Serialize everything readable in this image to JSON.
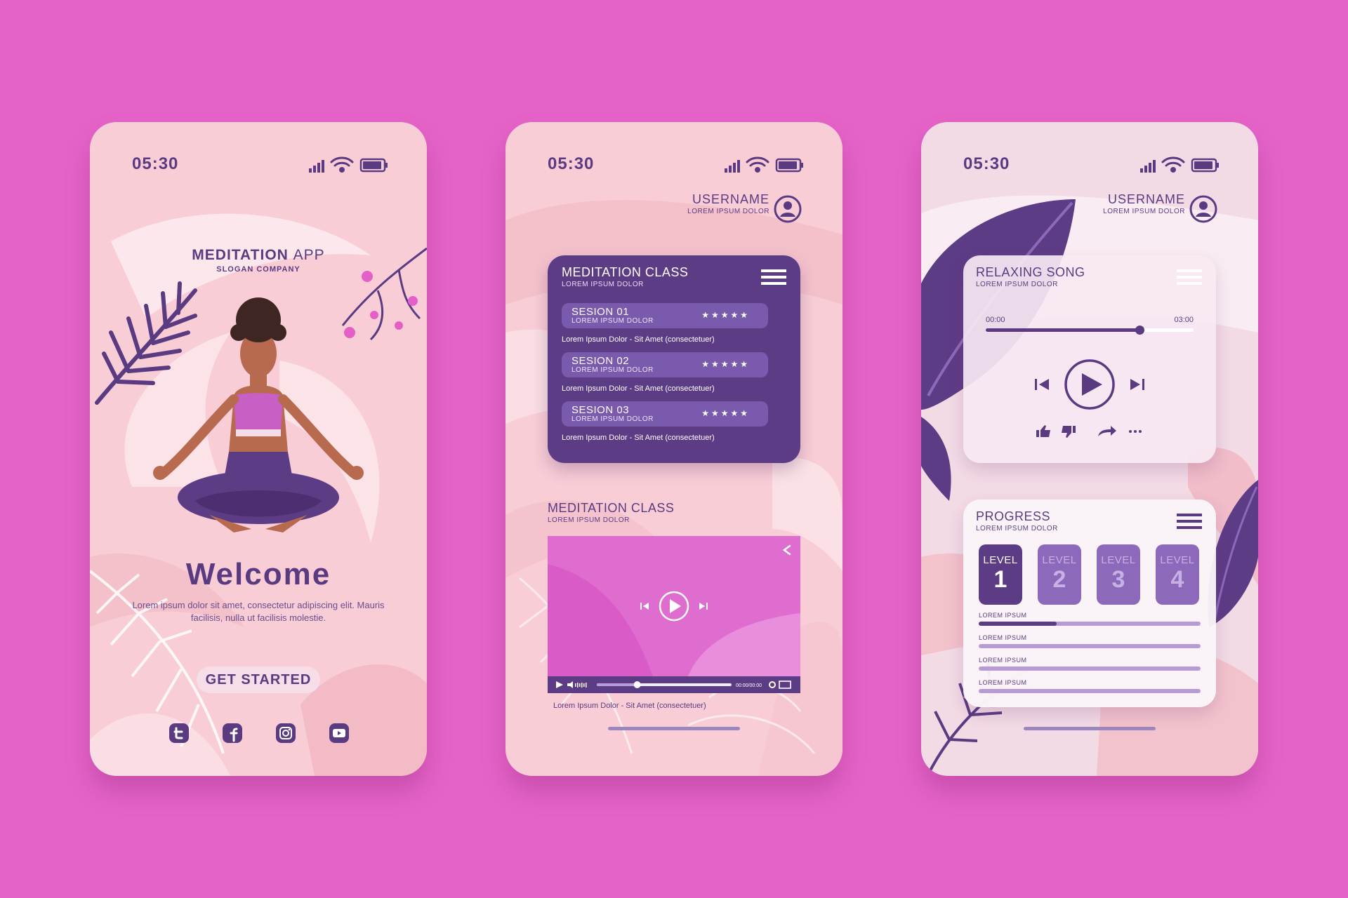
{
  "status": {
    "time": "05:30"
  },
  "welcome_screen": {
    "app_title_bold": "MEDITATION",
    "app_title_light": "APP",
    "slogan": "SLOGAN COMPANY",
    "welcome": "Welcome",
    "body_text": "Lorem ipsum dolor sit amet, consectetur adipiscing elit. Mauris facilisis, nulla ut facilisis molestie.",
    "cta_label": "GET STARTED",
    "social_icons": [
      "twitter-icon",
      "facebook-icon",
      "instagram-icon",
      "youtube-icon"
    ]
  },
  "class_screen": {
    "user": {
      "name": "USERNAME",
      "subtitle": "LOREM IPSUM DOLOR"
    },
    "card": {
      "title": "MEDITATION CLASS",
      "subtitle": "LOREM IPSUM DOLOR",
      "sessions": [
        {
          "name": "SESION 01",
          "sub": "LOREM IPSUM DOLOR",
          "stars": "★★★★★",
          "desc": "Lorem Ipsum Dolor - Sit Amet (consectetuer)"
        },
        {
          "name": "SESION 02",
          "sub": "LOREM IPSUM DOLOR",
          "stars": "★★★★★",
          "desc": "Lorem Ipsum Dolor - Sit Amet (consectetuer)"
        },
        {
          "name": "SESION 03",
          "sub": "LOREM IPSUM DOLOR",
          "stars": "★★★★★",
          "desc": "Lorem Ipsum Dolor - Sit Amet (consectetuer)"
        }
      ]
    },
    "video": {
      "title": "MEDITATION CLASS",
      "subtitle": "LOREM IPSUM DOLOR",
      "timecode": "00:00/00:00",
      "progress": 0.3,
      "caption": "Lorem Ipsum Dolor - Sit Amet (consectetuer)"
    }
  },
  "player_screen": {
    "user": {
      "name": "USERNAME",
      "subtitle": "LOREM IPSUM DOLOR"
    },
    "song": {
      "title": "RELAXING SONG",
      "subtitle": "LOREM IPSUM DOLOR",
      "time_start": "00:00",
      "time_end": "03:00",
      "progress": 0.74
    },
    "progress_card": {
      "title": "PROGRESS",
      "subtitle": "LOREM IPSUM DOLOR",
      "levels": [
        {
          "label": "LEVEL",
          "number": "1",
          "active": true
        },
        {
          "label": "LEVEL",
          "number": "2",
          "active": false
        },
        {
          "label": "LEVEL",
          "number": "3",
          "active": false
        },
        {
          "label": "LEVEL",
          "number": "4",
          "active": false
        }
      ],
      "items": [
        {
          "label": "LOREM IPSUM",
          "value": 0.35
        },
        {
          "label": "LOREM IPSUM",
          "value": 0
        },
        {
          "label": "LOREM IPSUM",
          "value": 0
        },
        {
          "label": "LOREM IPSUM",
          "value": 0
        }
      ]
    }
  },
  "colors": {
    "background": "#e563c8",
    "primary": "#5a3b82",
    "card_purple": "#5d3c86",
    "session_purple": "#7a5aac",
    "screen_pink": "#f8cdd6",
    "video_magenta": "#d95bc8"
  }
}
